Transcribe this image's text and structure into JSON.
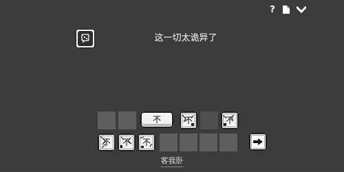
{
  "toolbar": {
    "help_label": "?",
    "icons": [
      "document-icon",
      "chevron-down-icon"
    ]
  },
  "dialogue": {
    "text": "这一切太诡异了"
  },
  "avatar": {
    "icon": "ghost-speech-icon"
  },
  "board": {
    "top_row": [
      {
        "type": "slot"
      },
      {
        "type": "slot"
      },
      {
        "type": "tile",
        "label": "不",
        "style": "selected"
      },
      {
        "type": "tile",
        "label": "不",
        "style": "cracked"
      },
      {
        "type": "slot"
      },
      {
        "type": "tile",
        "label": "不",
        "style": "cracked"
      }
    ],
    "bottom_row": [
      {
        "type": "tile",
        "label": "不",
        "style": "cracked"
      },
      {
        "type": "tile",
        "label": "不",
        "style": "cracked"
      },
      {
        "type": "tile",
        "label": "不",
        "style": "cracked"
      },
      {
        "type": "slot"
      },
      {
        "type": "slot"
      },
      {
        "type": "slot"
      },
      {
        "type": "slot"
      },
      {
        "type": "slot"
      }
    ],
    "next_icon": "arrow-right-icon"
  },
  "location": {
    "label": "客我卧"
  },
  "colors": {
    "background": "#3b3b3b",
    "slot": "#5e5e5e",
    "tile": "#f2f2f2"
  }
}
